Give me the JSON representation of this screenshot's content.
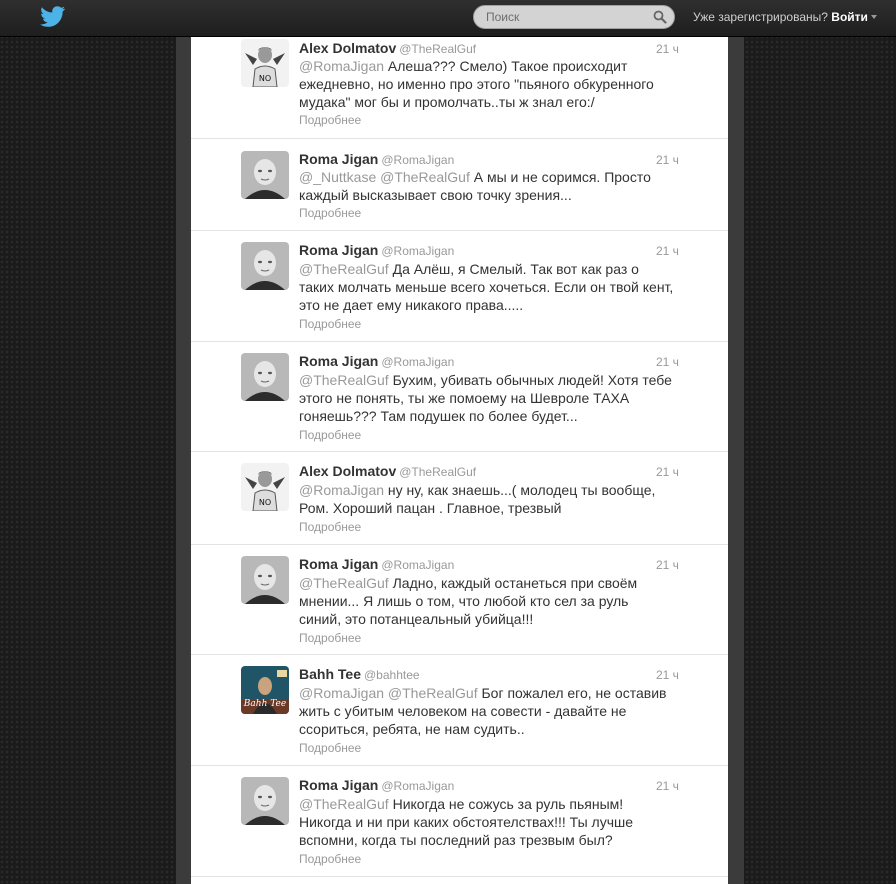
{
  "header": {
    "search_placeholder": "Поиск",
    "login_prompt": "Уже зарегистрированы?",
    "login_link": "Войти"
  },
  "tweets": [
    {
      "name": "Alex Dolmatov",
      "handle": "@TheRealGuf",
      "time": "21 ч",
      "mentions": "@RomaJigan",
      "text": " Алеша??? Смело) Такое происходит ежедневно, но именно про этого \"пьяного обкуренного мудака\" мог бы и промолчать..ты ж знал его:/",
      "more": "Подробнее",
      "avatar": "alex"
    },
    {
      "name": "Roma Jigan",
      "handle": "@RomaJigan",
      "time": "21 ч",
      "mentions": "@_Nuttkase @TheRealGuf",
      "text": " А мы и не соримся. Просто каждый высказывает свою точку зрения...",
      "more": "Подробнее",
      "avatar": "roma"
    },
    {
      "name": "Roma Jigan",
      "handle": "@RomaJigan",
      "time": "21 ч",
      "mentions": "@TheRealGuf",
      "text": " Да Алёш, я Смелый. Так вот как раз о таких молчать меньше всего хочеться. Если он твой кент, это не дает ему никакого права.....",
      "more": "Подробнее",
      "avatar": "roma"
    },
    {
      "name": "Roma Jigan",
      "handle": "@RomaJigan",
      "time": "21 ч",
      "mentions": "@TheRealGuf",
      "text": " Бухим, убивать обычных людей! Хотя тебе этого не понять, ты же помоему на Шевроле ТАХА гоняешь??? Там подушек по более будет...",
      "more": "Подробнее",
      "avatar": "roma"
    },
    {
      "name": "Alex Dolmatov",
      "handle": "@TheRealGuf",
      "time": "21 ч",
      "mentions": "@RomaJigan",
      "text": " ну ну, как знаешь...( молодец ты вообще, Ром. Хороший пацан . Главное, трезвый",
      "more": "Подробнее",
      "avatar": "alex"
    },
    {
      "name": "Roma Jigan",
      "handle": "@RomaJigan",
      "time": "21 ч",
      "mentions": "@TheRealGuf",
      "text": " Ладно, каждый останеться при своём мнении... Я лишь о том, что любой кто сел за руль синий, это потанцеальный убийца!!!",
      "more": "Подробнее",
      "avatar": "roma"
    },
    {
      "name": "Bahh Tee",
      "handle": "@bahhtee",
      "time": "21 ч",
      "mentions": "@RomaJigan @TheRealGuf",
      "text": " Бог пожалел его, не оставив жить с убитым человеком на совести - давайте не ссориться, ребята, не нам судить..",
      "more": "Подробнее",
      "avatar": "bahh",
      "avatar_caption": "Bahh Tee"
    },
    {
      "name": "Roma Jigan",
      "handle": "@RomaJigan",
      "time": "21 ч",
      "mentions": "@TheRealGuf",
      "text": " Никогда не сожусь за руль пьяным! Никогда и ни при каких обстоятелствах!!! Ты лучше вспомни, когда ты последний раз трезвым был?",
      "more": "Подробнее",
      "avatar": "roma"
    }
  ]
}
